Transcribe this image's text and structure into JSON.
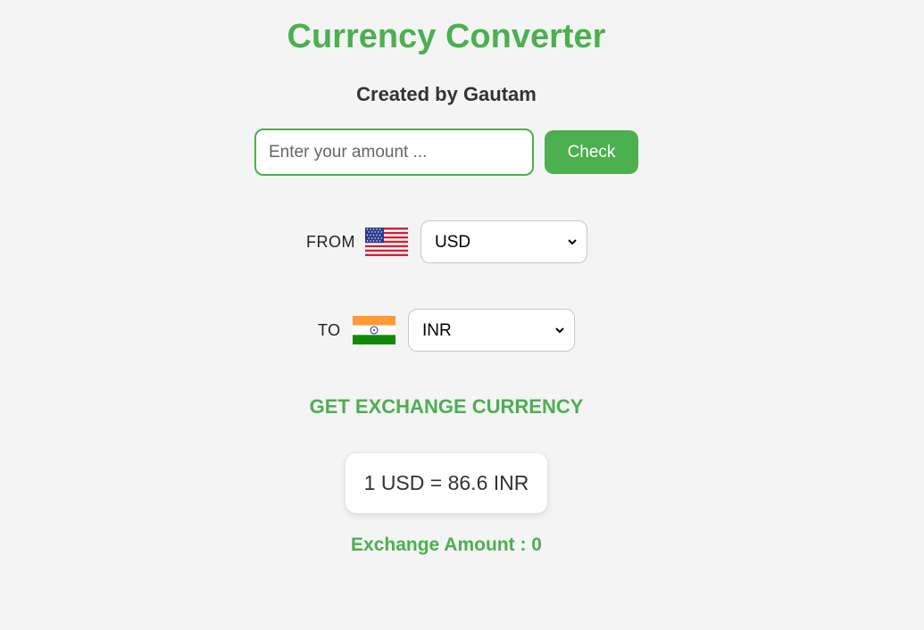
{
  "header": {
    "title": "Currency Converter",
    "subtitle": "Created by Gautam"
  },
  "amount": {
    "placeholder": "Enter your amount ...",
    "value": "",
    "check_label": "Check"
  },
  "from": {
    "label": "FROM",
    "flag_icon": "us-flag-icon",
    "selected": "USD"
  },
  "to": {
    "label": "TO",
    "flag_icon": "india-flag-icon",
    "selected": "INR"
  },
  "exchange": {
    "heading": "GET EXCHANGE CURRENCY",
    "rate_text": "1 USD = 86.6 INR",
    "amount_text": "Exchange Amount : 0"
  },
  "colors": {
    "accent": "#4caf50",
    "background": "#f4f4f4"
  }
}
